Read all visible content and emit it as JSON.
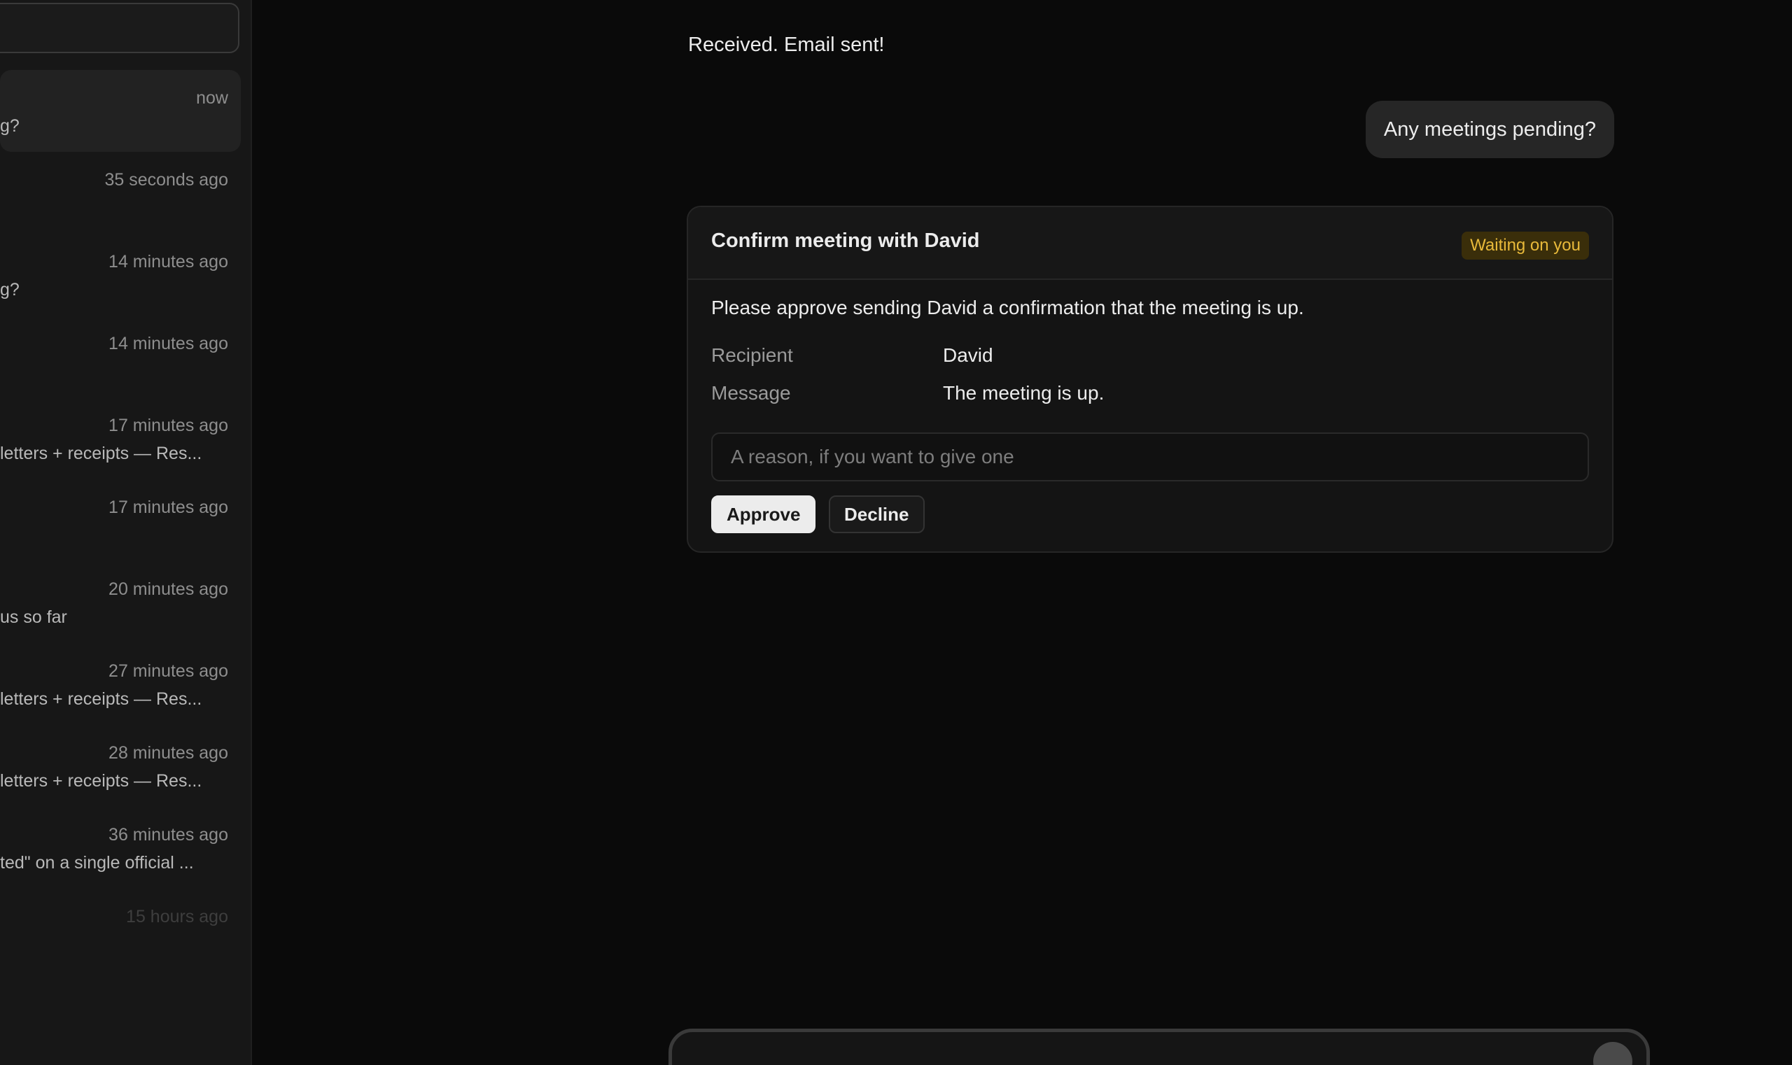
{
  "sidebar": {
    "threads": [
      {
        "time": "now",
        "snippet": "g?",
        "active": true
      },
      {
        "time": "35 seconds ago",
        "snippet": ""
      },
      {
        "time": "14 minutes ago",
        "snippet": "g?"
      },
      {
        "time": "14 minutes ago",
        "snippet": ""
      },
      {
        "time": "17 minutes ago",
        "snippet": "letters + receipts — Res..."
      },
      {
        "time": "17 minutes ago",
        "snippet": ""
      },
      {
        "time": "20 minutes ago",
        "snippet": "us so far"
      },
      {
        "time": "27 minutes ago",
        "snippet": "letters + receipts — Res..."
      },
      {
        "time": "28 minutes ago",
        "snippet": "letters + receipts — Res..."
      },
      {
        "time": "36 minutes ago",
        "snippet": "ted\" on a single official ..."
      },
      {
        "time": "15 hours ago",
        "snippet": ""
      }
    ]
  },
  "chat": {
    "assistant_message": "Received. Email sent!",
    "user_message": "Any meetings pending?"
  },
  "approval": {
    "title": "Confirm meeting with David",
    "status": "Waiting on you",
    "description": "Please approve sending David a confirmation that the meeting is up.",
    "fields": {
      "recipient_label": "Recipient",
      "recipient_value": "David",
      "message_label": "Message",
      "message_value": "The meeting is up."
    },
    "reason_placeholder": "A reason, if you want to give one",
    "approve_label": "Approve",
    "decline_label": "Decline"
  },
  "colors": {
    "background": "#0a0a0a",
    "sidebar": "#171717",
    "status_badge_text": "#e8b93a",
    "status_badge_bg": "#3a2e0a"
  }
}
